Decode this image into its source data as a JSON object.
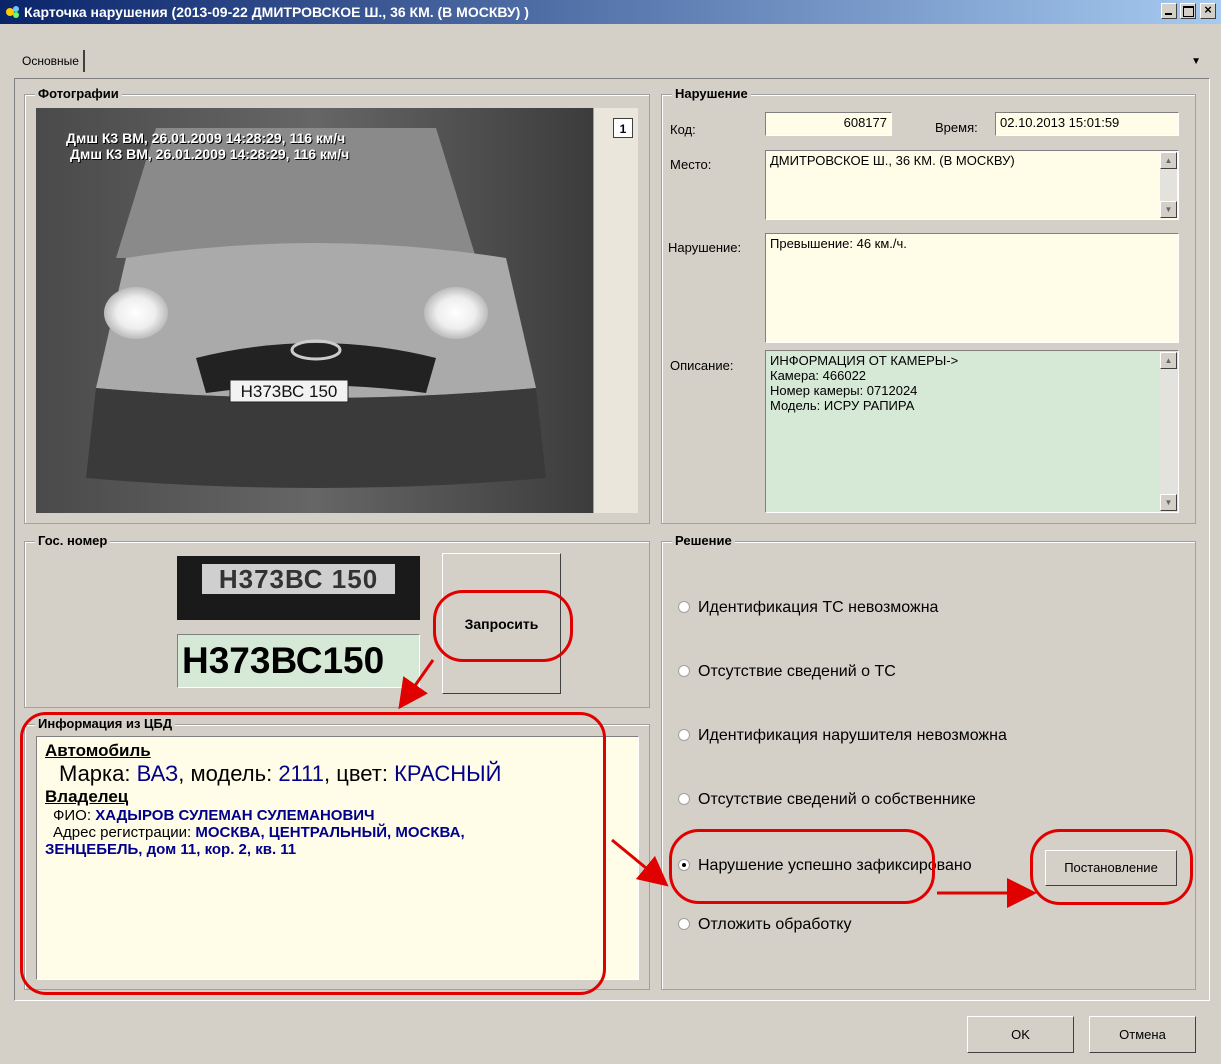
{
  "window": {
    "title": "Карточка нарушения (2013-09-22 ДМИТРОВСКОЕ Ш., 36 КМ. (В МОСКВУ) )"
  },
  "tabs": {
    "main": "Основные"
  },
  "photos": {
    "title": "Фотографии",
    "caption1": "Дмш К3 ВМ, 26.01.2009 14:28:29, 116 км/ч",
    "caption2": "Дмш К3 ВМ, 26.01.2009 14:28:29, 116 км/ч",
    "plate_text": "Н373ВС 150",
    "page_number": "1"
  },
  "violation": {
    "title": "Нарушение",
    "code_label": "Код:",
    "code_value": "608177",
    "time_label": "Время:",
    "time_value": "02.10.2013 15:01:59",
    "place_label": "Место:",
    "place_value": "ДМИТРОВСКОЕ Ш., 36 КМ. (В МОСКВУ)",
    "violation_label": "Нарушение:",
    "violation_value": "Превышение: 46 км./ч.",
    "description_label": "Описание:",
    "description_lines": [
      "ИНФОРМАЦИЯ ОТ КАМЕРЫ->",
      "Камера: 466022",
      "Номер камеры: 0712024",
      "Модель: ИСРУ РАПИРА"
    ]
  },
  "plate": {
    "title": "Гос. номер",
    "plate_crop_text": "Н373ВС 150",
    "plate_value": "Н373ВС150",
    "request_button": "Запросить"
  },
  "cbd": {
    "title": "Информация из ЦБД",
    "car_heading": "Автомобиль",
    "make_label": "Марка:",
    "make_value": "ВАЗ",
    "model_label": "модель:",
    "model_value": "2111",
    "color_label": "цвет:",
    "color_value": "КРАСНЫЙ",
    "owner_heading": "Владелец",
    "fio_label": "ФИО:",
    "fio_value": "ХАДЫРОВ СУЛЕМАН СУЛЕМАНОВИЧ",
    "address_label": "Адрес регистрации:",
    "address_value_1": "МОСКВА, ЦЕНТРАЛЬНЫЙ, МОСКВА,",
    "address_value_2": "ЗЕНЦЕБЕЛЬ, дом 11, кор. 2, кв. 11"
  },
  "decision": {
    "title": "Решение",
    "options": [
      "Идентификация ТС невозможна",
      "Отсутствие сведений о ТС",
      "Идентификация нарушителя невозможна",
      "Отсутствие сведений о собственнике",
      "Нарушение успешно зафиксировано",
      "Отложить обработку"
    ],
    "selected_index": 4,
    "resolution_button": "Постановление"
  },
  "footer": {
    "ok": "OK",
    "cancel": "Отмена"
  },
  "colors": {
    "annotation": "#e00000",
    "value_text": "#00008b",
    "field_bg": "#fffde8",
    "description_bg": "#d6e8d6"
  }
}
